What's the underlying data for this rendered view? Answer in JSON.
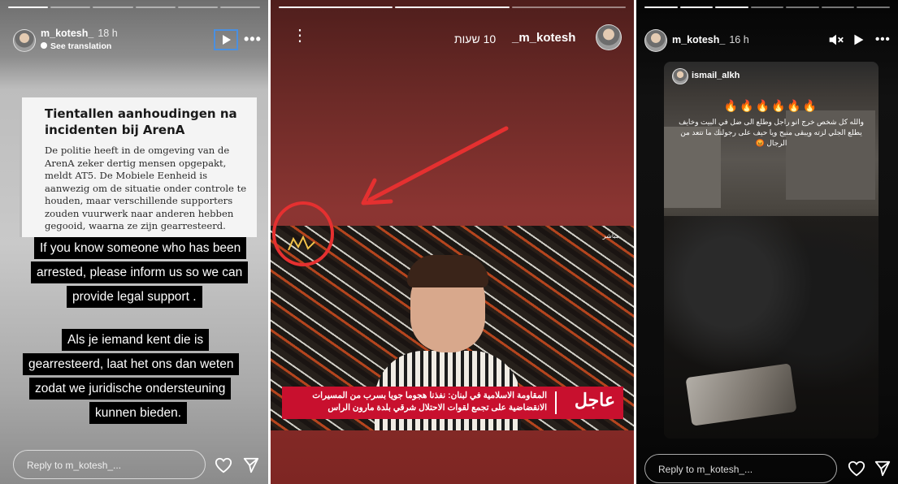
{
  "panel1": {
    "username": "m_kotesh_",
    "time": "18 h",
    "see_translation": "See translation",
    "article_title": "Tientallen aanhoudingen na incidenten bij ArenA",
    "article_body": "De politie heeft in de omgeving van de ArenA zeker dertig mensen opgepakt, meldt AT5. De Mobiele Eenheid is aanwezig om de situatie onder controle te houden, maar verschillende supporters zouden vuurwerk naar anderen hebben gegooid, waarna ze zijn gearresteerd.",
    "caption_en": [
      "If you know someone who has been",
      "arrested, please inform us so we can",
      "provide legal support ."
    ],
    "caption_nl": [
      "Als je iemand kent die is",
      "gearresteerd, laat het ons dan weten",
      "zodat we juridische ondersteuning",
      "kunnen bieden."
    ],
    "reply_placeholder": "Reply to m_kotesh_...",
    "icons": {
      "play": "play-icon",
      "more": "more-icon",
      "like": "heart-icon",
      "send": "send-icon"
    }
  },
  "panel2": {
    "username": "_m_kotesh",
    "time": "10 שעות",
    "breaking_label": "عاجل",
    "live_label": "مباشر",
    "breaking_text": [
      "المقاومة الاسلامية في لبنان: نفذنا هجوما جويا بسرب من المسيرات",
      "الانقضاضية على تجمع لقوات الاحتلال شرقي بلدة مارون الراس"
    ],
    "annotation_colors": {
      "arrow": "#e53030",
      "circle": "#e53030"
    },
    "icons": {
      "menu": "vertical-dots-icon"
    }
  },
  "panel3": {
    "username": "m_kotesh_",
    "time": "16 h",
    "reel_username": "ismail_alkh",
    "reel_emojis": "🔥🔥🔥🔥🔥🔥",
    "reel_text": "والله كل شخص خرج انو راجل وطلع الى ضل في البيت وخايف يطلع الجلي لزته ويبقى منيح ويا حيف على رجولتك ما تتعد من الرجال 😡",
    "reply_placeholder": "Reply to m_kotesh_...",
    "icons": {
      "mute": "mute-icon",
      "play": "play-icon",
      "more": "more-icon",
      "like": "heart-icon",
      "send": "send-icon"
    }
  }
}
